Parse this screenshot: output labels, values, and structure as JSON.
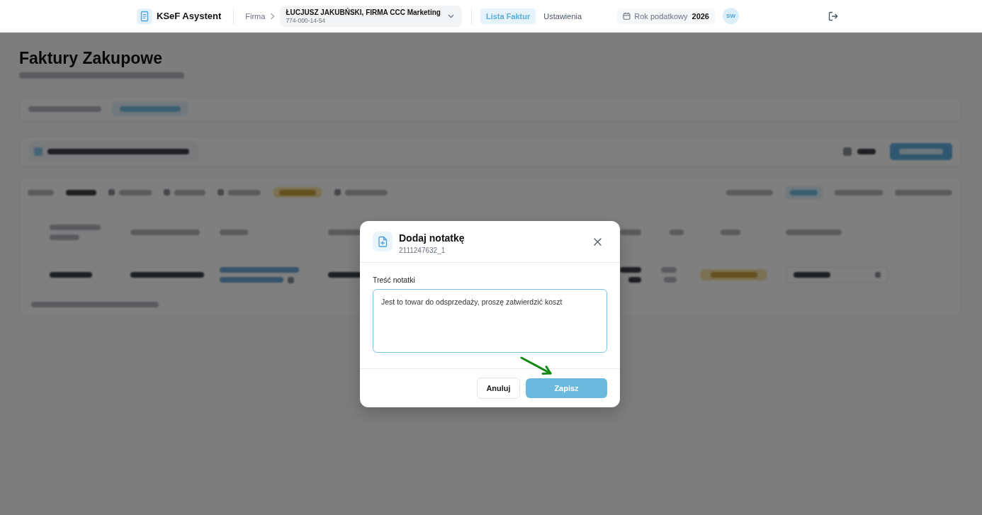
{
  "header": {
    "app_name": "KSeF Asystent",
    "company_label": "Firma",
    "company": {
      "name": "ŁUCJUSZ JAKUBŃSKI, FIRMA CCC Marketing",
      "nip": "774-000-14-54"
    },
    "nav": [
      {
        "label": "Lista Faktur",
        "selected": true
      },
      {
        "label": "Ustawienia",
        "selected": false
      }
    ],
    "tax_year": {
      "label": "Rok podatkowy",
      "value": "2026"
    },
    "user_initials": "SW"
  },
  "page": {
    "title": "Faktury Zakupowe"
  },
  "dialog": {
    "title": "Dodaj notatkę",
    "subtitle": "2111247632_1",
    "field": {
      "label": "Treść notatki",
      "value": "Jest to towar do odsprzedaży, proszę zatwierdzić koszt"
    },
    "buttons": [
      {
        "label": "Anuluj",
        "kind": "secondary"
      },
      {
        "label": "Zapisz",
        "kind": "primary"
      }
    ]
  },
  "annotations": [
    {
      "kind": "arrow"
    }
  ]
}
